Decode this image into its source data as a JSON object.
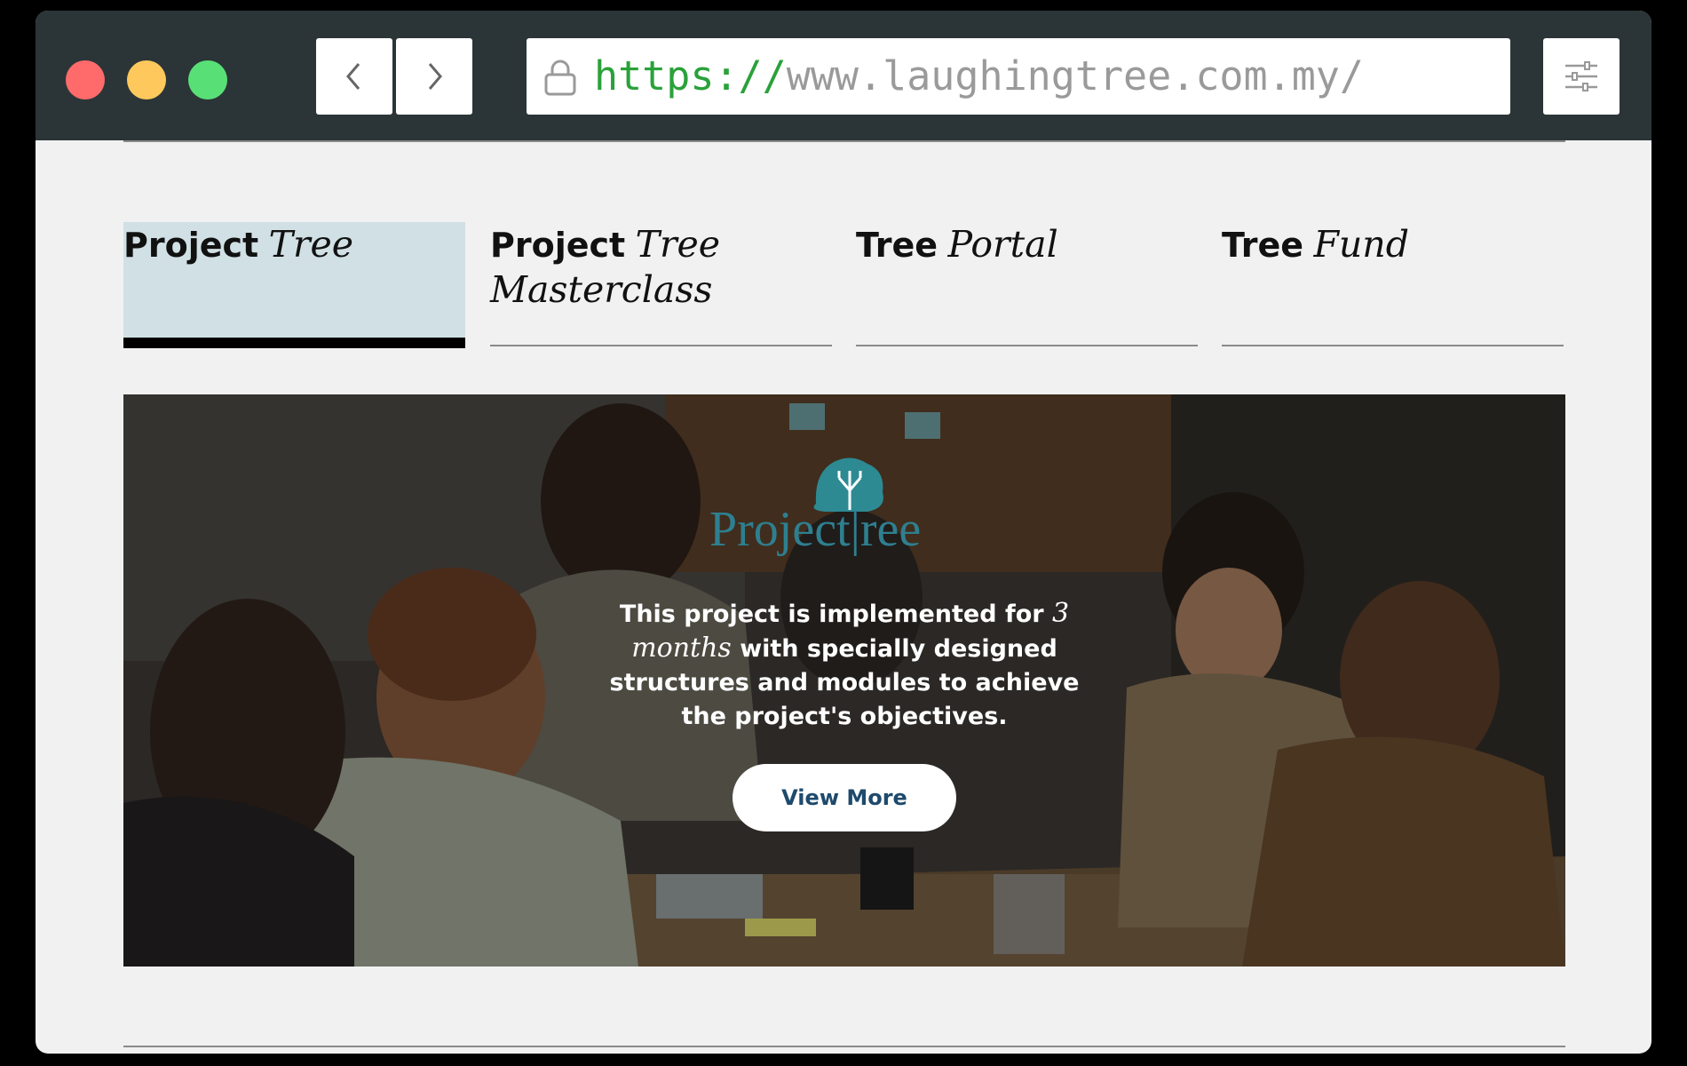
{
  "browser": {
    "url_scheme": "https://",
    "url_rest": "www.laughingtree.com.my/"
  },
  "tabs": [
    {
      "bold": "Project",
      "italic": "Tree",
      "active": true
    },
    {
      "bold": "Project",
      "italic": "Tree Masterclass",
      "active": false
    },
    {
      "bold": "Tree",
      "italic": "Portal",
      "active": false
    },
    {
      "bold": "Tree",
      "italic": "Fund",
      "active": false
    }
  ],
  "hero": {
    "logo_text": "Project|ree",
    "desc_1": "This project is implemented for",
    "desc_italic": "3 months",
    "desc_2": "with specially designed structures and modules to achieve the project's objectives.",
    "button": "View More"
  },
  "colors": {
    "titlebar": "#2b3537",
    "active_tab": "#d1e0e5",
    "logo": "#2e7f90",
    "button_text": "#1e4a6c"
  }
}
